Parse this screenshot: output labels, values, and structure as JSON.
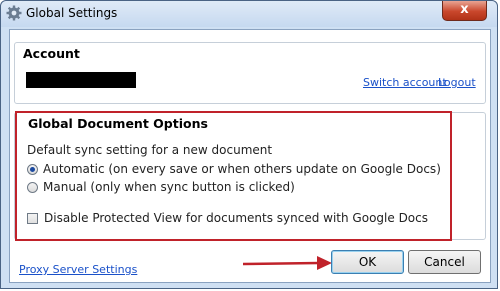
{
  "window": {
    "title": "Global Settings",
    "close_glyph": "x",
    "icon": "gear-icon"
  },
  "account": {
    "heading": "Account",
    "switch_label": "Switch account",
    "logout_label": "Logout"
  },
  "options": {
    "heading": "Global Document Options",
    "sync_label": "Default sync setting for a new document",
    "radio_auto": "Automatic (on every save or when others update on Google Docs)",
    "radio_manual": "Manual (only when sync button is clicked)",
    "selected_sync": "Automatic",
    "checkbox_label": "Disable Protected View for documents synced with Google Docs",
    "checkbox_checked": false
  },
  "footer": {
    "proxy_label": "Proxy Server Settings",
    "ok_label": "OK",
    "cancel_label": "Cancel"
  },
  "colors": {
    "highlight": "#c0222a",
    "link": "#1a51c9"
  }
}
